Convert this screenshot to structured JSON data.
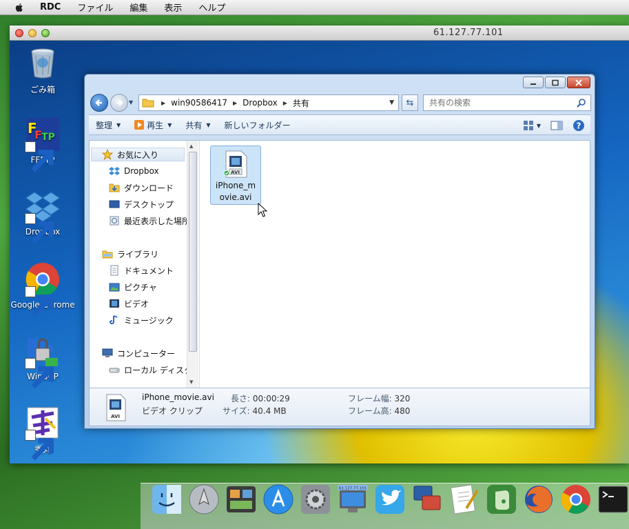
{
  "menubar": {
    "app": "RDC",
    "items": [
      "ファイル",
      "編集",
      "表示",
      "ヘルプ"
    ]
  },
  "rdc_window": {
    "title": "61.127.77.101"
  },
  "desktop_icons": [
    {
      "label": "ごみ箱",
      "icon": "recycle-bin-icon"
    },
    {
      "label": "FFFTP",
      "icon": "ffftp-icon"
    },
    {
      "label": "Dropbox",
      "icon": "dropbox-icon"
    },
    {
      "label": "Google Chrome",
      "icon": "chrome-icon"
    },
    {
      "label": "WinSCP",
      "icon": "winscp-icon"
    },
    {
      "label": "秀丸",
      "icon": "hidemaru-icon"
    }
  ],
  "explorer": {
    "breadcrumb": [
      "win90586417",
      "Dropbox",
      "共有"
    ],
    "search_placeholder": "共有の検索",
    "toolbar": {
      "organize": "整理",
      "play": "再生",
      "share": "共有",
      "new_folder": "新しいフォルダー"
    },
    "nav": {
      "favorites": "お気に入り",
      "fav_items": [
        "Dropbox",
        "ダウンロード",
        "デスクトップ",
        "最近表示した場所"
      ],
      "libraries": "ライブラリ",
      "lib_items": [
        "ドキュメント",
        "ピクチャ",
        "ビデオ",
        "ミュージック"
      ],
      "computer": "コンピューター",
      "comp_items": [
        "ローカル ディスク"
      ]
    },
    "file": {
      "name_line1": "iPhone_m",
      "name_line2": "ovie.avi",
      "badge": "AVI"
    },
    "details": {
      "filename": "iPhone_movie.avi",
      "type": "ビデオ クリップ",
      "length_label": "長さ:",
      "length_value": "00:00:29",
      "size_label": "サイズ:",
      "size_value": "40.4 MB",
      "frame_width_label": "フレーム幅:",
      "frame_width_value": "320",
      "frame_height_label": "フレーム高:",
      "frame_height_value": "480"
    }
  },
  "dock": {
    "items": [
      "finder-icon",
      "launchpad-icon",
      "photo-icon",
      "app-store-icon",
      "system-preferences-icon",
      "rdc-icon",
      "twitter-icon",
      "parallels-icon",
      "pages-icon",
      "evernote-icon",
      "firefox-icon",
      "chrome-icon",
      "terminal-icon"
    ],
    "rdc_badge": "61.127.77.101"
  }
}
